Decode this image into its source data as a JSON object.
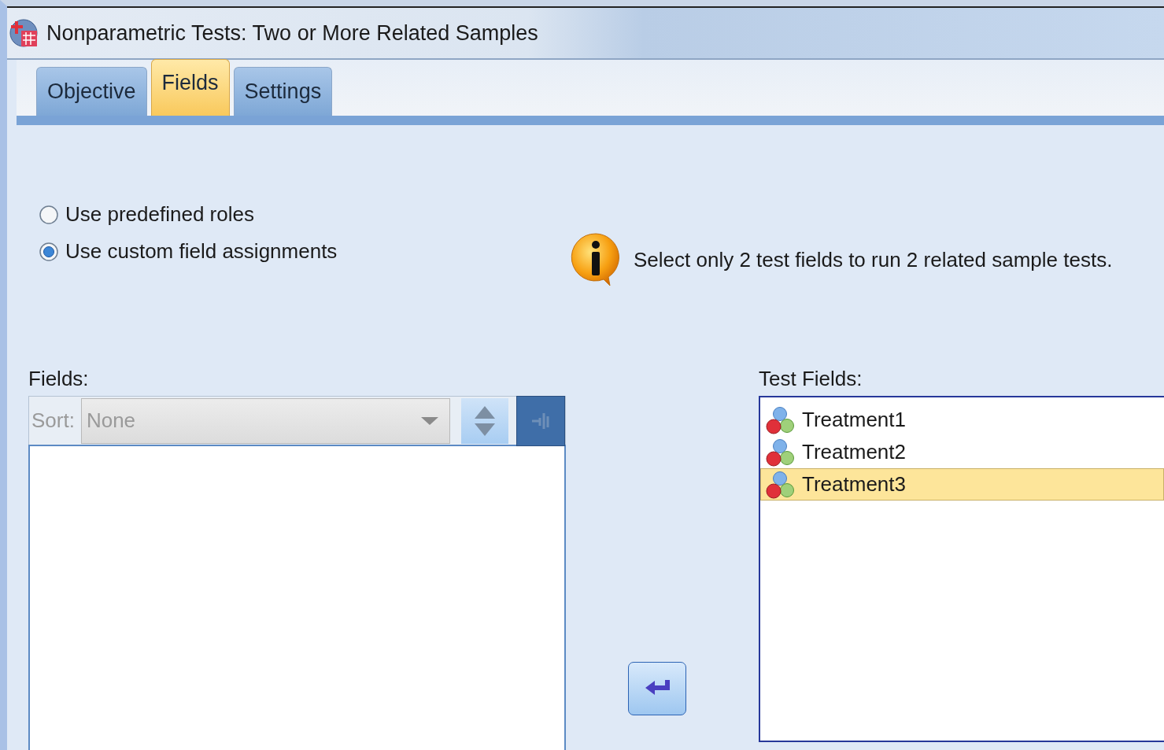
{
  "window": {
    "title": "Nonparametric Tests: Two or More Related Samples"
  },
  "tabs": [
    {
      "label": "Objective",
      "selected": false
    },
    {
      "label": "Fields",
      "selected": true
    },
    {
      "label": "Settings",
      "selected": false
    }
  ],
  "role_options": [
    {
      "label": "Use predefined roles",
      "selected": false
    },
    {
      "label": "Use custom field assignments",
      "selected": true
    }
  ],
  "info_message": "Select only 2 test fields to run 2 related sample tests.",
  "fields_panel": {
    "label": "Fields:",
    "sort_label": "Sort:",
    "sort_value": "None",
    "disabled": true
  },
  "test_fields": {
    "label": "Test Fields:",
    "items": [
      {
        "name": "Treatment1",
        "selected": false
      },
      {
        "name": "Treatment2",
        "selected": false
      },
      {
        "name": "Treatment3",
        "selected": true
      }
    ]
  }
}
